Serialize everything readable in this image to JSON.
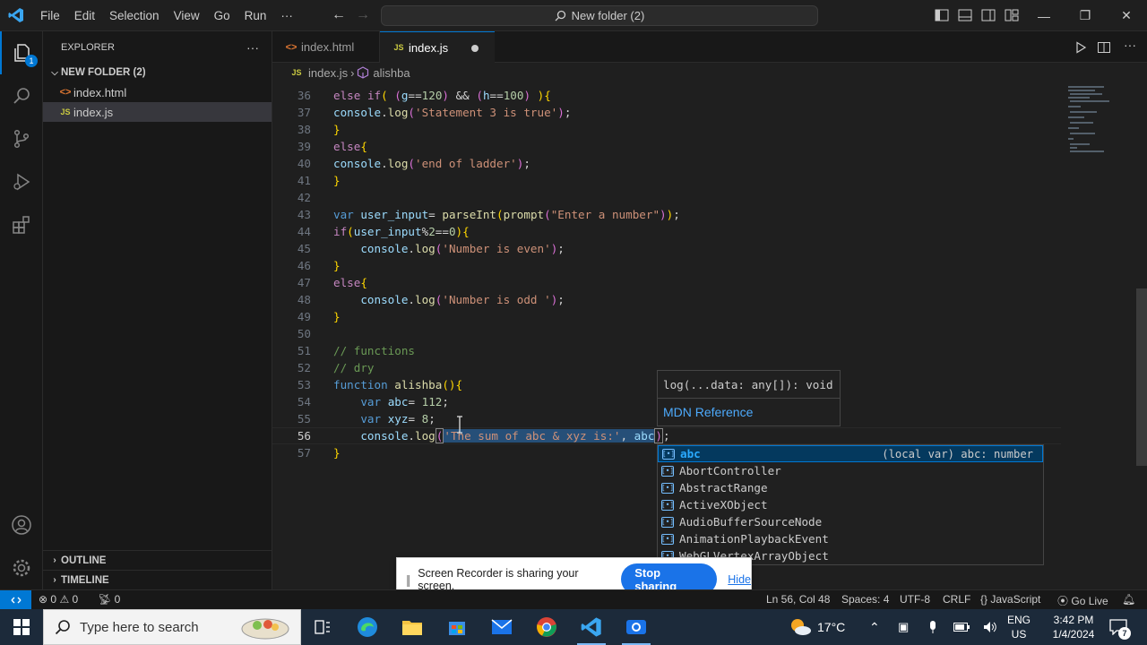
{
  "window": {
    "title": "New folder (2)",
    "menu": [
      "File",
      "Edit",
      "Selection",
      "View",
      "Go",
      "Run",
      "···"
    ]
  },
  "activity": {
    "explorer_badge": "1"
  },
  "explorer": {
    "title": "EXPLORER",
    "more": "···",
    "folder": "NEW FOLDER (2)",
    "files": [
      {
        "name": "index.html",
        "icon": "<>"
      },
      {
        "name": "index.js",
        "icon": "JS"
      }
    ],
    "outline": "OUTLINE",
    "timeline": "TIMELINE"
  },
  "tabs": [
    {
      "label": "index.html",
      "icon": "<>"
    },
    {
      "label": "index.js",
      "icon": "JS",
      "modified": true
    }
  ],
  "breadcrumb": {
    "file": "index.js",
    "symbol": "alishba",
    "file_icon": "JS",
    "separator": "›"
  },
  "editor": {
    "current_line": 56,
    "lines": [
      {
        "n": "36"
      },
      {
        "n": "37"
      },
      {
        "n": "38"
      },
      {
        "n": "39"
      },
      {
        "n": "40"
      },
      {
        "n": "41"
      },
      {
        "n": "42"
      },
      {
        "n": "43"
      },
      {
        "n": "44"
      },
      {
        "n": "45"
      },
      {
        "n": "46"
      },
      {
        "n": "47"
      },
      {
        "n": "48"
      },
      {
        "n": "49"
      },
      {
        "n": "50"
      },
      {
        "n": "51"
      },
      {
        "n": "52"
      },
      {
        "n": "53"
      },
      {
        "n": "54"
      },
      {
        "n": "55"
      },
      {
        "n": "56"
      },
      {
        "n": "57"
      }
    ]
  },
  "hover": {
    "signature": "log(...data: any[]): void",
    "link": "MDN Reference"
  },
  "suggest": {
    "items": [
      {
        "label": "abc",
        "detail": "(local var) abc: number"
      },
      {
        "label": "AbortController"
      },
      {
        "label": "AbstractRange"
      },
      {
        "label": "ActiveXObject"
      },
      {
        "label": "AudioBufferSourceNode"
      },
      {
        "label": "AnimationPlaybackEvent"
      },
      {
        "label": "WebGLVertexArrayObject"
      }
    ]
  },
  "recorder": {
    "message": "Screen Recorder is sharing your screen.",
    "stop": "Stop sharing",
    "hide": "Hide"
  },
  "status": {
    "errors": "0",
    "warnings": "0",
    "ports": "0",
    "position": "Ln 56, Col 48",
    "spaces": "Spaces: 4",
    "encoding": "UTF-8",
    "eol": "CRLF",
    "language": "JavaScript",
    "golive": "Go Live"
  },
  "taskbar": {
    "search_placeholder": "Type here to search",
    "temperature": "17°C",
    "lang": "ENG",
    "region": "US",
    "time": "3:42 PM",
    "date": "1/4/2024",
    "notifications": "7"
  },
  "colors": {
    "accent": "#0078d4",
    "editor_bg": "#1f1f1f",
    "sidebar_bg": "#181818"
  }
}
